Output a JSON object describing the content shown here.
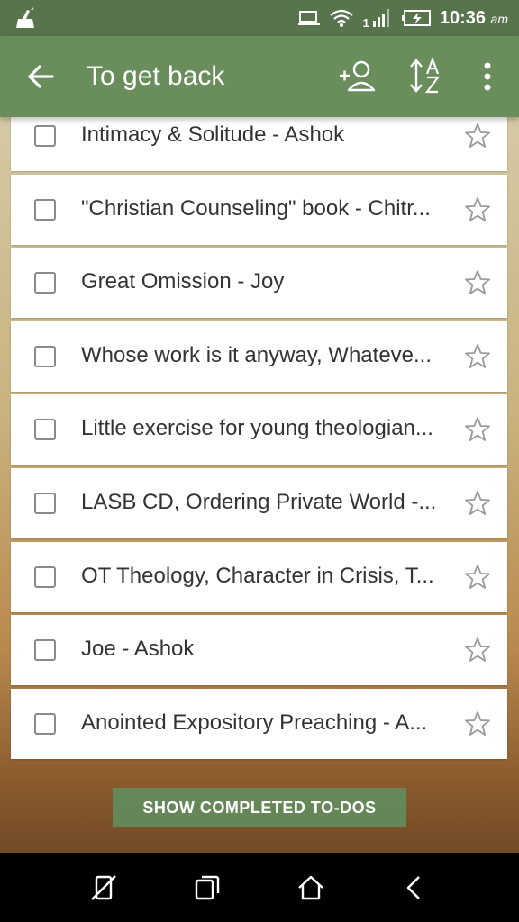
{
  "status_bar": {
    "time": "10:36",
    "ampm": "am",
    "network_type": "1",
    "icons": [
      "cleaner-icon",
      "cast-icon",
      "wifi-icon",
      "signal-icon",
      "battery-icon"
    ]
  },
  "app_bar": {
    "title": "To get back",
    "icons": [
      "back-arrow-icon",
      "add-person-icon",
      "sort-az-icon",
      "overflow-menu-icon"
    ]
  },
  "todos": [
    {
      "text": "Intimacy & Solitude - Ashok",
      "checked": false,
      "starred": false
    },
    {
      "text": "\"Christian Counseling\" book - Chitr...",
      "checked": false,
      "starred": false
    },
    {
      "text": "Great Omission - Joy",
      "checked": false,
      "starred": false
    },
    {
      "text": "Whose work is it anyway, Whateve...",
      "checked": false,
      "starred": false
    },
    {
      "text": "Little exercise for young theologian...",
      "checked": false,
      "starred": false
    },
    {
      "text": "LASB CD, Ordering Private World -...",
      "checked": false,
      "starred": false
    },
    {
      "text": "OT Theology, Character in Crisis, T...",
      "checked": false,
      "starred": false
    },
    {
      "text": "Joe - Ashok",
      "checked": false,
      "starred": false
    },
    {
      "text": "Anointed Expository Preaching - A...",
      "checked": false,
      "starred": false
    }
  ],
  "show_completed_label": "SHOW COMPLETED TO-DOS",
  "nav_bar": {
    "icons": [
      "screenshot-icon",
      "recent-apps-icon",
      "home-icon",
      "back-nav-icon"
    ]
  },
  "colors": {
    "status_bar": "#58744c",
    "app_bar": "#6a8d5c",
    "button": "#638c5c"
  }
}
